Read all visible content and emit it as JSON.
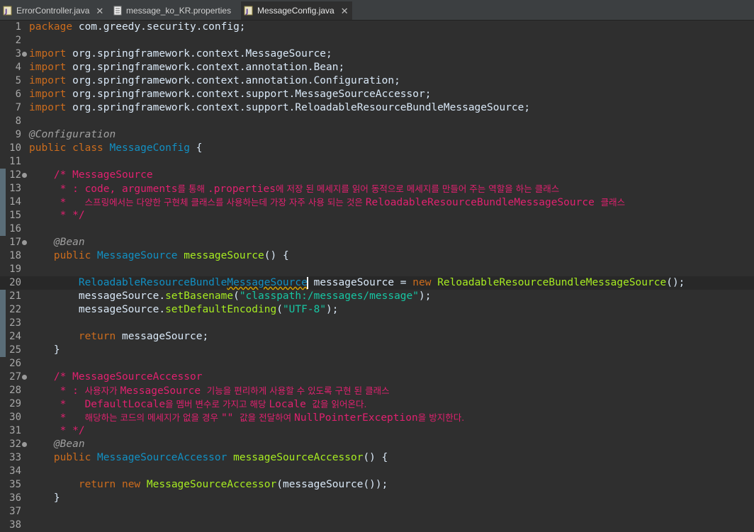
{
  "tabs": [
    {
      "label": "ErrorController.java",
      "icon": "java-file-icon",
      "active": false
    },
    {
      "label": "message_ko_KR.properties",
      "icon": "properties-file-icon",
      "active": false
    },
    {
      "label": "MessageConfig.java",
      "icon": "java-file-icon",
      "active": true
    }
  ],
  "lines": [
    {
      "n": "1",
      "segs": [
        [
          "kw",
          "package"
        ],
        [
          "pl",
          " com.greedy.security.config;"
        ]
      ]
    },
    {
      "n": "2",
      "segs": []
    },
    {
      "n": "3",
      "segs": [
        [
          "kw",
          "import"
        ],
        [
          "pl",
          " org.springframework.context.MessageSource;"
        ]
      ]
    },
    {
      "n": "4",
      "segs": [
        [
          "kw",
          "import"
        ],
        [
          "pl",
          " org.springframework.context.annotation.Bean;"
        ]
      ]
    },
    {
      "n": "5",
      "segs": [
        [
          "kw",
          "import"
        ],
        [
          "pl",
          " org.springframework.context.annotation.Configuration;"
        ]
      ]
    },
    {
      "n": "6",
      "segs": [
        [
          "kw",
          "import"
        ],
        [
          "pl",
          " org.springframework.context.support.MessageSourceAccessor;"
        ]
      ]
    },
    {
      "n": "7",
      "segs": [
        [
          "kw",
          "import"
        ],
        [
          "pl",
          " org.springframework.context.support.ReloadableResourceBundleMessageSource;"
        ]
      ]
    },
    {
      "n": "8",
      "segs": []
    },
    {
      "n": "9",
      "segs": [
        [
          "ann",
          "@Configuration"
        ]
      ]
    },
    {
      "n": "10",
      "segs": [
        [
          "kw",
          "public"
        ],
        [
          "pl",
          " "
        ],
        [
          "kw",
          "class"
        ],
        [
          "pl",
          " "
        ],
        [
          "cls",
          "MessageConfig"
        ],
        [
          "pl",
          " {"
        ]
      ]
    },
    {
      "n": "11",
      "segs": []
    },
    {
      "n": "12",
      "segs": [
        [
          "cm",
          "    /* MessageSource"
        ]
      ]
    },
    {
      "n": "13",
      "segs": [
        [
          "cm",
          "     * : code, arguments"
        ],
        [
          "cmk",
          "를 통해 "
        ],
        [
          "cm",
          ".properties"
        ],
        [
          "cmk",
          "에 저장 된 메세지를 읽어 동적으로 메세지를 만들어 주는 역할을 하는 클래스"
        ]
      ]
    },
    {
      "n": "14",
      "segs": [
        [
          "cm",
          "     *   "
        ],
        [
          "cmk",
          "스프링에서는 다양한 구현체 클래스를 사용하는데 가장 자주 사용 되는 것은 "
        ],
        [
          "cm",
          "ReloadableResourceBundleMessageSource "
        ],
        [
          "cmk",
          "클래스"
        ]
      ]
    },
    {
      "n": "15",
      "segs": [
        [
          "cm",
          "     * */"
        ]
      ]
    },
    {
      "n": "16",
      "segs": []
    },
    {
      "n": "17",
      "segs": [
        [
          "pl",
          "    "
        ],
        [
          "ann",
          "@Bean"
        ]
      ]
    },
    {
      "n": "18",
      "segs": [
        [
          "pl",
          "    "
        ],
        [
          "kw",
          "public"
        ],
        [
          "pl",
          " "
        ],
        [
          "cls",
          "MessageSource"
        ],
        [
          "pl",
          " "
        ],
        [
          "mth",
          "messageSource"
        ],
        [
          "pl",
          "() {"
        ]
      ]
    },
    {
      "n": "19",
      "segs": []
    },
    {
      "n": "20",
      "segs": [
        [
          "pl",
          "        "
        ],
        [
          "cls",
          "ReloadableResourceBundle"
        ],
        [
          "clserr",
          "MessageSource"
        ],
        [
          "caret",
          ""
        ],
        [
          "pl",
          " messageSource = "
        ],
        [
          "kw",
          "new"
        ],
        [
          "pl",
          " "
        ],
        [
          "ctor",
          "ReloadableResourceBundleMessageSource"
        ],
        [
          "pl",
          "();"
        ]
      ]
    },
    {
      "n": "21",
      "segs": [
        [
          "pl",
          "        messageSource."
        ],
        [
          "mth",
          "setBasename"
        ],
        [
          "pl",
          "("
        ],
        [
          "str",
          "\"classpath:/messages/message\""
        ],
        [
          "pl",
          ");"
        ]
      ]
    },
    {
      "n": "22",
      "segs": [
        [
          "pl",
          "        messageSource."
        ],
        [
          "mth",
          "setDefaultEncoding"
        ],
        [
          "pl",
          "("
        ],
        [
          "str",
          "\"UTF-8\""
        ],
        [
          "pl",
          ");"
        ]
      ]
    },
    {
      "n": "23",
      "segs": []
    },
    {
      "n": "24",
      "segs": [
        [
          "pl",
          "        "
        ],
        [
          "kw",
          "return"
        ],
        [
          "pl",
          " messageSource;"
        ]
      ]
    },
    {
      "n": "25",
      "segs": [
        [
          "pl",
          "    }"
        ]
      ]
    },
    {
      "n": "26",
      "segs": []
    },
    {
      "n": "27",
      "segs": [
        [
          "cm",
          "    /* MessageSourceAccessor"
        ]
      ]
    },
    {
      "n": "28",
      "segs": [
        [
          "cm",
          "     * : "
        ],
        [
          "cmk",
          "사용자가 "
        ],
        [
          "cm",
          "MessageSource "
        ],
        [
          "cmk",
          "기능을 편리하게 사용할 수 있도록 구현 된 클래스"
        ]
      ]
    },
    {
      "n": "29",
      "segs": [
        [
          "cm",
          "     *   DefaultLocale"
        ],
        [
          "cmk",
          "을 멤버 변수로 가지고 해당 "
        ],
        [
          "cm",
          "Locale "
        ],
        [
          "cmk",
          "값을 읽어온다."
        ]
      ]
    },
    {
      "n": "30",
      "segs": [
        [
          "cm",
          "     *   "
        ],
        [
          "cmk",
          "해당하는 코드의 메세지가 없을 경우 "
        ],
        [
          "cm",
          "\"\" "
        ],
        [
          "cmk",
          "값을 전달하여 "
        ],
        [
          "cm",
          "NullPointerException"
        ],
        [
          "cmk",
          "을 방지한다."
        ]
      ]
    },
    {
      "n": "31",
      "segs": [
        [
          "cm",
          "     * */"
        ]
      ]
    },
    {
      "n": "32",
      "segs": [
        [
          "pl",
          "    "
        ],
        [
          "ann",
          "@Bean"
        ]
      ]
    },
    {
      "n": "33",
      "segs": [
        [
          "pl",
          "    "
        ],
        [
          "kw",
          "public"
        ],
        [
          "pl",
          " "
        ],
        [
          "cls",
          "MessageSourceAccessor"
        ],
        [
          "pl",
          " "
        ],
        [
          "mth",
          "messageSourceAccessor"
        ],
        [
          "pl",
          "() {"
        ]
      ]
    },
    {
      "n": "34",
      "segs": []
    },
    {
      "n": "35",
      "segs": [
        [
          "pl",
          "        "
        ],
        [
          "kw",
          "return"
        ],
        [
          "pl",
          " "
        ],
        [
          "kw",
          "new"
        ],
        [
          "pl",
          " "
        ],
        [
          "ctor",
          "MessageSourceAccessor"
        ],
        [
          "pl",
          "(messageSource());"
        ]
      ]
    },
    {
      "n": "36",
      "segs": [
        [
          "pl",
          "    }"
        ]
      ]
    },
    {
      "n": "37",
      "segs": []
    },
    {
      "n": "38",
      "segs": []
    }
  ],
  "fold_lines": [
    "3",
    "12",
    "17",
    "27",
    "32"
  ],
  "current_line": "20",
  "colors": {
    "keyword": "#cc6c1d",
    "annotation": "#a0a0a0",
    "class": "#1290c3",
    "method": "#a7ec21",
    "string": "#17c6a3",
    "comment": "#e0216f",
    "plain": "#d9e8f7",
    "background": "#2f2f2f"
  }
}
